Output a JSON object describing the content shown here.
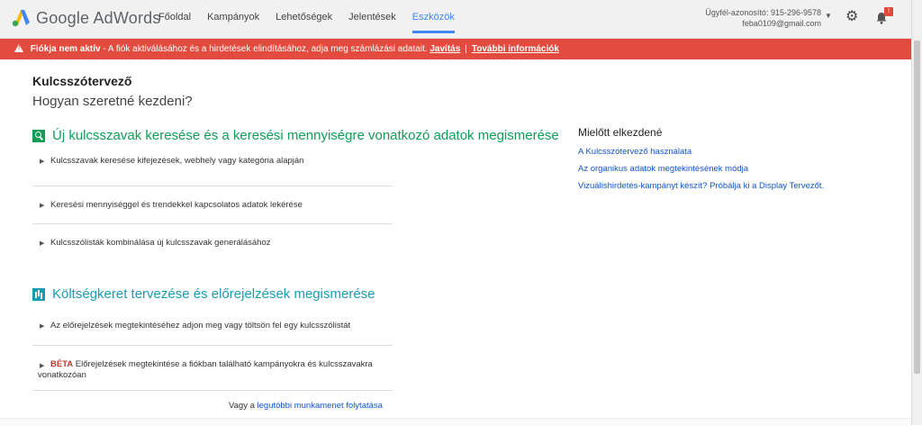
{
  "header": {
    "brand": "Google AdWords",
    "nav": [
      "Főoldal",
      "Kampányok",
      "Lehetőségek",
      "Jelentések",
      "Eszközök"
    ],
    "active_nav": "Eszközök",
    "account_id_line": "Ügyfél-azonosító: 915-296-9578",
    "account_email": "feba0109@gmail.com",
    "notifications_badge": "!"
  },
  "banner": {
    "bold": "Fiókja nem aktív",
    "text": " - A fiók aktiválásához és a hirdetések elindításához, adja meg számlázási adatait.",
    "link_fix": "Javítás",
    "separator": "|",
    "link_more": "További információk"
  },
  "page": {
    "title": "Kulcsszótervező",
    "subtitle": "Hogyan szeretné kezdeni?"
  },
  "section1": {
    "heading": "Új kulcsszavak keresése és a keresési mennyiségre vonatkozó adatok megismerése",
    "options": [
      "Kulcsszavak keresése kifejezések, webhely vagy kategória alapján",
      "Keresési mennyiséggel és trendekkel kapcsolatos adatok lekérése",
      "Kulcsszólisták kombinálása új kulcsszavak generálásához"
    ]
  },
  "section2": {
    "heading": "Költségkeret tervezése és előrejelzések megismerése",
    "options": [
      "Az előrejelzések megtekintéséhez adjon meg vagy töltsön fel egy kulcsszólistát"
    ],
    "beta_label": "BÉTA",
    "beta_option": " Előrejelzések megtekintése a fiókban található kampányokra és kulcsszavakra vonatkozóan"
  },
  "sidebar": {
    "title": "Mielőtt elkezdené",
    "links": [
      "A Kulcsszótervező használata",
      "Az organikus adatok megtekintésének módja",
      "Vizuálishirdetés-kampányt készít? Próbálja ki a Display Tervezőt."
    ]
  },
  "resume": {
    "prefix": "Vagy a ",
    "link": "legutóbbi munkamenet folytatása"
  },
  "colors": {
    "banner_red": "#e44b3f",
    "active_blue": "#4285f4",
    "green_heading": "#0f9d58",
    "teal_heading": "#1a9bb5",
    "link_blue": "#1155cc"
  }
}
